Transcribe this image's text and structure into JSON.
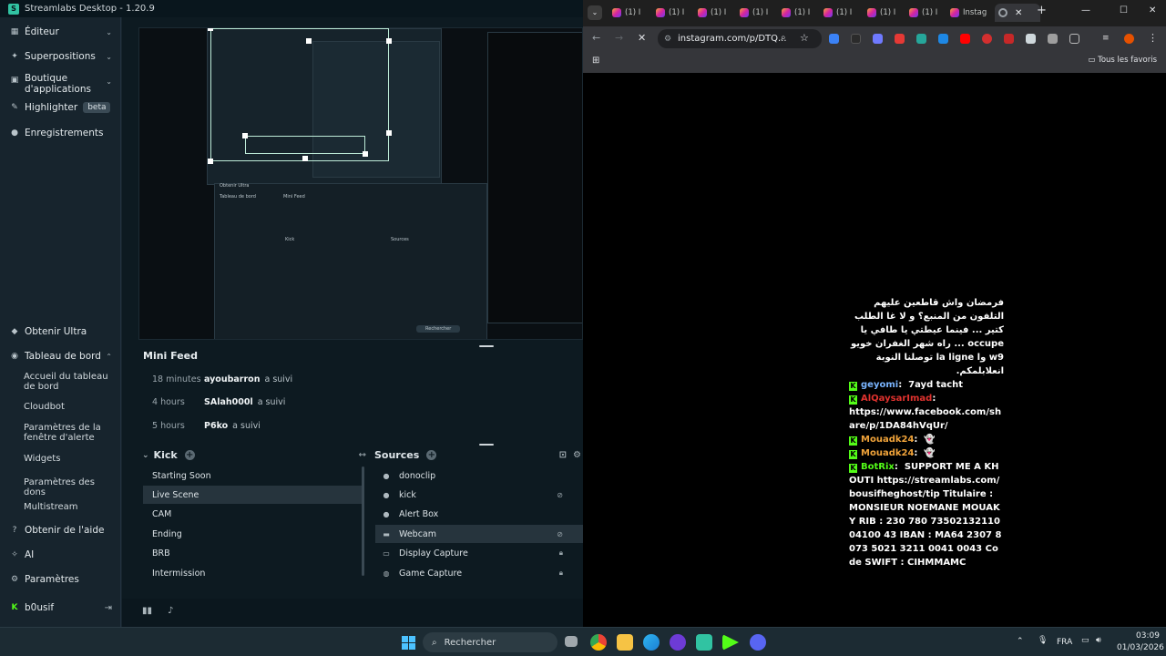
{
  "streamlabs": {
    "title": "Streamlabs Desktop - 1.20.9",
    "sidebar": {
      "items": [
        {
          "label": "Éditeur"
        },
        {
          "label": "Superpositions"
        },
        {
          "label": "Boutique d'applications"
        },
        {
          "label": "Highlighter",
          "badge": "beta"
        },
        {
          "label": "Enregistrements"
        }
      ],
      "bottom": {
        "ultra": "Obtenir Ultra",
        "dashboard": "Tableau de bord",
        "dashboard_sub": [
          "Accueil du tableau de bord",
          "Cloudbot",
          "Paramètres de la fenêtre d'alerte",
          "Widgets",
          "Paramètres des dons",
          "Multistream"
        ],
        "help": "Obtenir de l'aide",
        "ai": "AI",
        "settings": "Paramètres",
        "user": "b0usif"
      }
    },
    "minifeed": {
      "title": "Mini Feed",
      "rows": [
        {
          "time": "18 minutes",
          "user": "ayoubarron",
          "action": "a suivi"
        },
        {
          "time": "4 hours",
          "user": "SAlah000l",
          "action": "a suivi"
        },
        {
          "time": "5 hours",
          "user": "P6ko",
          "action": "a suivi"
        }
      ]
    },
    "scenes": {
      "title": "Kick",
      "items": [
        "Starting Soon",
        "Live Scene",
        "CAM",
        "Ending",
        "BRB",
        "Intermission"
      ],
      "active_index": 1
    },
    "sources": {
      "title": "Sources",
      "items": [
        "donoclip",
        "kick",
        "Alert Box",
        "Webcam",
        "Display Capture",
        "Game Capture"
      ],
      "active_index": 3
    }
  },
  "chrome": {
    "active_tab": "Instag",
    "inactive_tab_label": "(1) I",
    "url": "instagram.com/p/DTQ...",
    "bookmarks_all": "Tous les favoris",
    "chat": {
      "rtl_message": "فرمضان واش قاطعين عليهم التلفون من المنبع؟ و لا غا الطلب كتير ... فينما عيطتي يا طافي يا occupe ... راه شهر الغفران خويو w9 وا la ligne توصلنا النوبة انعلابلمكم.",
      "lines": [
        {
          "user": "geyomi",
          "color": "#7ab5ff",
          "text": "7ayd tacht"
        },
        {
          "user": "AlQaysarImad",
          "color": "#e0322e",
          "text": "https://www.facebook.com/share/p/1DA84hVqUr/"
        },
        {
          "user": "Mouadk24",
          "color": "#f0a33a",
          "text": "👻"
        },
        {
          "user": "Mouadk24",
          "color": "#f0a33a",
          "text": "👻"
        },
        {
          "user": "BotRix",
          "color": "#53fc18",
          "text": "SUPPORT ME A KHOUTI https://streamlabs.com/bousifheghost/tip Titulaire : MONSIEUR NOEMANE MOUAKY RIB : 230 780 7350213211004100 43 IBAN : MA64 2307 8073 5021 3211 0041 0043 Code SWIFT : CIHMMAMC"
        }
      ]
    }
  },
  "taskbar": {
    "search": "Rechercher",
    "lang": "FRA",
    "time": "03:09",
    "date": "01/03/2026"
  },
  "colors": {
    "accent": "#31c3a2",
    "kick_green": "#53fc18"
  }
}
